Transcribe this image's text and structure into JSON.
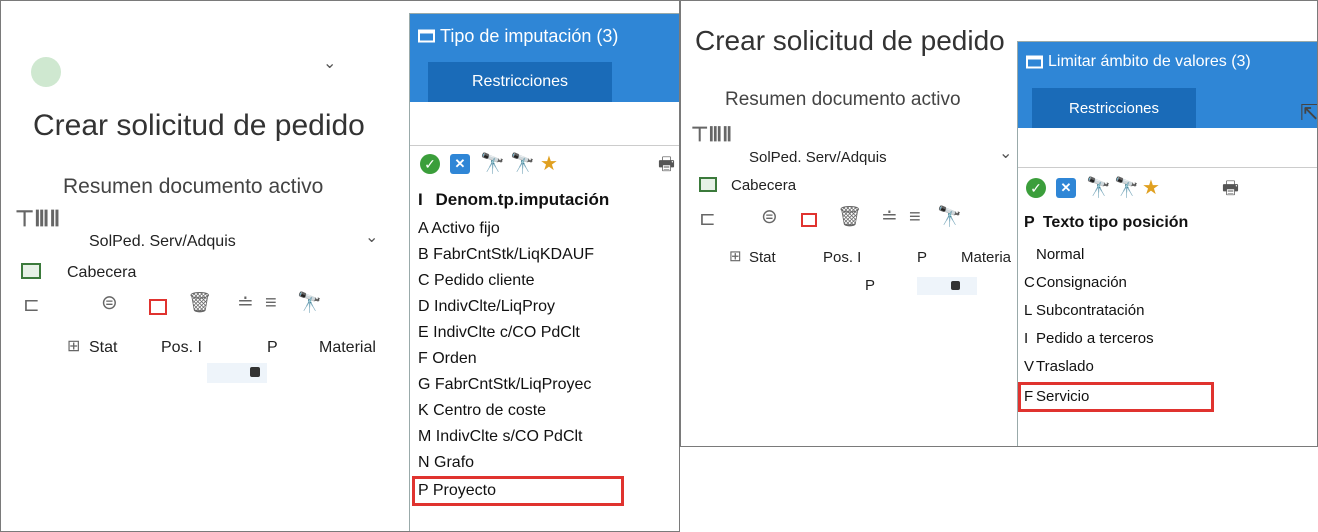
{
  "left": {
    "title": "Crear solicitud de pedido",
    "subtitle": "Resumen documento activo",
    "solped_label": "SolPed. Serv/Adquis",
    "cabecera_label": "Cabecera",
    "columns": [
      "Stat",
      "Pos. I",
      "P",
      "Material"
    ],
    "popup": {
      "title": "Tipo de imputación (3)",
      "tab": "Restricciones",
      "header_col": "I",
      "header_label": "Denom.tp.imputación",
      "rows": [
        {
          "code": "A",
          "label": "Activo fijo"
        },
        {
          "code": "B",
          "label": "FabrCntStk/LiqKDAUF"
        },
        {
          "code": "C",
          "label": "Pedido cliente"
        },
        {
          "code": "D",
          "label": "IndivClte/LiqProy"
        },
        {
          "code": "E",
          "label": "IndivClte c/CO PdClt"
        },
        {
          "code": "F",
          "label": "Orden"
        },
        {
          "code": "G",
          "label": "FabrCntStk/LiqProyec"
        },
        {
          "code": "K",
          "label": "Centro de coste"
        },
        {
          "code": "M",
          "label": "IndivClte s/CO PdClt"
        },
        {
          "code": "N",
          "label": "Grafo"
        },
        {
          "code": "P",
          "label": "Proyecto"
        }
      ]
    }
  },
  "right": {
    "title": "Crear solicitud de pedido",
    "subtitle": "Resumen documento activo",
    "solped_label": "SolPed. Serv/Adquis",
    "cabecera_label": "Cabecera",
    "columns": [
      "Stat",
      "Pos. I",
      "P",
      "Materia"
    ],
    "col_p_value": "P",
    "popup": {
      "title": "Limitar ámbito de valores (3)",
      "tab": "Restricciones",
      "header_col": "P",
      "header_label": "Texto tipo posición",
      "rows": [
        {
          "code": "",
          "label": "Normal"
        },
        {
          "code": "C",
          "label": "Consignación"
        },
        {
          "code": "L",
          "label": "Subcontratación"
        },
        {
          "code": "I",
          "label": "Pedido a terceros"
        },
        {
          "code": "V",
          "label": "Traslado"
        },
        {
          "code": "F",
          "label": "Servicio"
        }
      ]
    }
  },
  "colors": {
    "sap_blue": "#2f86d6",
    "highlight_red": "#e0332f",
    "check_green": "#3b9e3b"
  }
}
